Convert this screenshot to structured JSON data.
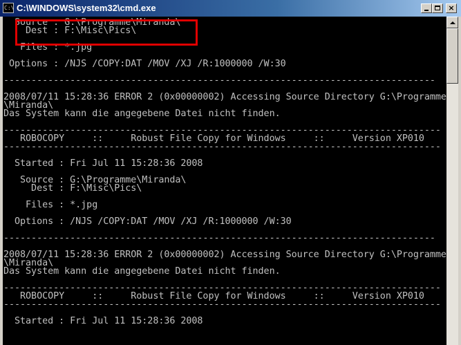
{
  "window": {
    "title": "C:\\WINDOWS\\system32\\cmd.exe",
    "icon_label": "C:\\"
  },
  "titlebar_buttons": {
    "minimize": "minimize",
    "maximize": "maximize",
    "close": "×"
  },
  "console": {
    "lines": [
      "  Source : G:\\Programme\\Miranda\\",
      "    Dest : F:\\Misc\\Pics\\",
      "",
      "   Files : *.jpg",
      "",
      " Options : /NJS /COPY:DAT /MOV /XJ /R:1000000 /W:30",
      "",
      "------------------------------------------------------------------------------",
      "",
      "2008/07/11 15:28:36 ERROR 2 (0x00000002) Accessing Source Directory G:\\Programme",
      "\\Miranda\\",
      "Das System kann die angegebene Datei nicht finden.",
      "",
      "-------------------------------------------------------------------------------",
      "   ROBOCOPY     ::     Robust File Copy for Windows     ::     Version XP010",
      "-------------------------------------------------------------------------------",
      "",
      "  Started : Fri Jul 11 15:28:36 2008",
      "",
      "   Source : G:\\Programme\\Miranda\\",
      "     Dest : F:\\Misc\\Pics\\",
      "",
      "    Files : *.jpg",
      "",
      "  Options : /NJS /COPY:DAT /MOV /XJ /R:1000000 /W:30",
      "",
      "------------------------------------------------------------------------------",
      "",
      "2008/07/11 15:28:36 ERROR 2 (0x00000002) Accessing Source Directory G:\\Programme",
      "\\Miranda\\",
      "Das System kann die angegebene Datei nicht finden.",
      "",
      "-------------------------------------------------------------------------------",
      "   ROBOCOPY     ::     Robust File Copy for Windows     ::     Version XP010",
      "-------------------------------------------------------------------------------",
      "",
      "  Started : Fri Jul 11 15:28:36 2008",
      ""
    ]
  },
  "colors": {
    "console_bg": "#000000",
    "console_fg": "#c0c0c0",
    "highlight": "#e00000"
  }
}
